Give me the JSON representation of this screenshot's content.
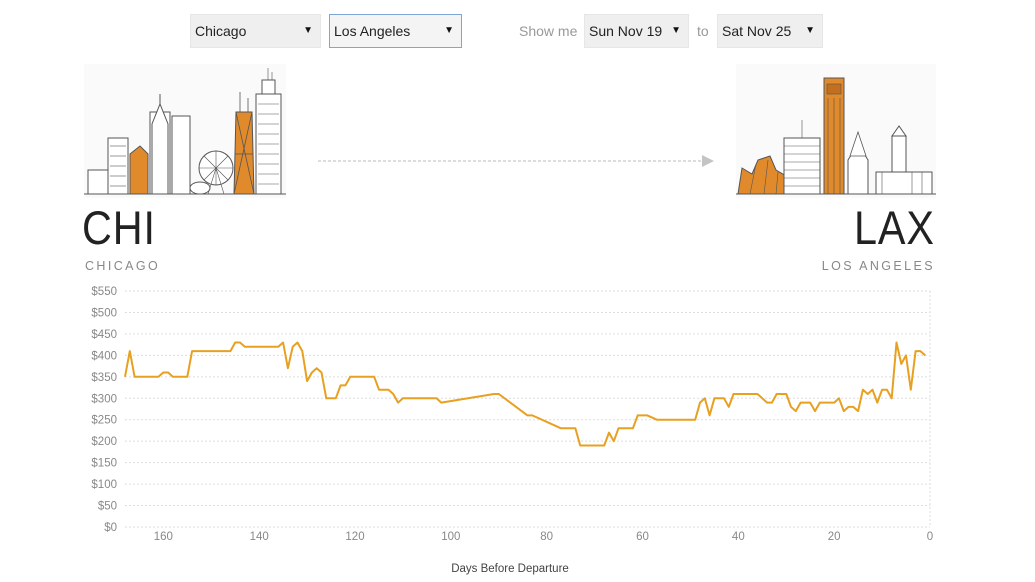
{
  "controls": {
    "origin_select": "Chicago",
    "destination_select": "Los Angeles",
    "show_me_label": "Show me",
    "date_from": "Sun Nov 19",
    "to_label": "to",
    "date_to": "Sat Nov 25"
  },
  "route": {
    "origin_code": "CHI",
    "origin_name": "CHICAGO",
    "destination_code": "LAX",
    "destination_name": "LOS ANGELES"
  },
  "colors": {
    "line": "#e8a020",
    "accent_orange": "#e08a2c",
    "grid": "#dddddd"
  },
  "chart_data": {
    "type": "line",
    "xlabel": "Days Before Departure",
    "ylabel": "",
    "xlim": [
      168,
      0
    ],
    "ylim": [
      0,
      550
    ],
    "x_reversed": true,
    "x_ticks": [
      160,
      140,
      120,
      100,
      80,
      60,
      40,
      20,
      0
    ],
    "y_ticks": [
      0,
      50,
      100,
      150,
      200,
      250,
      300,
      350,
      400,
      450,
      500,
      550
    ],
    "y_tick_labels": [
      "$0",
      "$50",
      "$100",
      "$150",
      "$200",
      "$250",
      "$300",
      "$350",
      "$400",
      "$450",
      "$500",
      "$550"
    ],
    "grid": true,
    "series": [
      {
        "x": [
          168,
          167,
          166,
          165,
          161,
          160,
          159,
          158,
          155,
          154,
          146,
          145,
          144,
          143,
          136,
          135,
          134,
          133,
          132,
          131,
          130,
          129,
          128,
          127,
          126,
          125,
          124,
          123,
          122,
          121,
          116,
          115,
          113,
          112,
          111,
          110,
          106,
          104,
          103,
          102,
          91,
          90,
          84,
          83,
          77,
          74,
          73,
          68,
          67,
          66,
          65,
          64,
          62,
          61,
          60,
          59,
          57,
          56,
          51,
          50,
          49,
          48,
          47,
          46,
          45,
          44,
          43,
          42,
          41,
          40,
          39,
          38,
          37,
          36,
          34,
          33,
          32,
          31,
          30,
          29,
          28,
          27,
          26,
          25,
          24,
          23,
          22,
          21,
          20,
          19,
          18,
          17,
          16,
          15,
          14,
          13,
          12,
          11,
          10,
          9,
          8,
          7,
          6,
          5,
          4,
          3,
          2,
          1
        ],
        "y": [
          350,
          410,
          350,
          350,
          350,
          360,
          360,
          350,
          350,
          410,
          410,
          430,
          430,
          420,
          420,
          430,
          370,
          420,
          430,
          410,
          340,
          360,
          370,
          360,
          300,
          300,
          300,
          330,
          330,
          350,
          350,
          320,
          320,
          310,
          290,
          300,
          300,
          300,
          300,
          290,
          310,
          310,
          260,
          260,
          230,
          230,
          190,
          190,
          220,
          200,
          230,
          230,
          230,
          260,
          260,
          260,
          250,
          250,
          250,
          250,
          250,
          290,
          300,
          260,
          300,
          300,
          300,
          280,
          310,
          310,
          310,
          310,
          310,
          310,
          290,
          290,
          310,
          310,
          310,
          280,
          270,
          290,
          290,
          290,
          270,
          290,
          290,
          290,
          290,
          300,
          270,
          280,
          280,
          270,
          320,
          310,
          320,
          290,
          320,
          320,
          300,
          430,
          380,
          400,
          320,
          410,
          410,
          400
        ]
      }
    ]
  }
}
